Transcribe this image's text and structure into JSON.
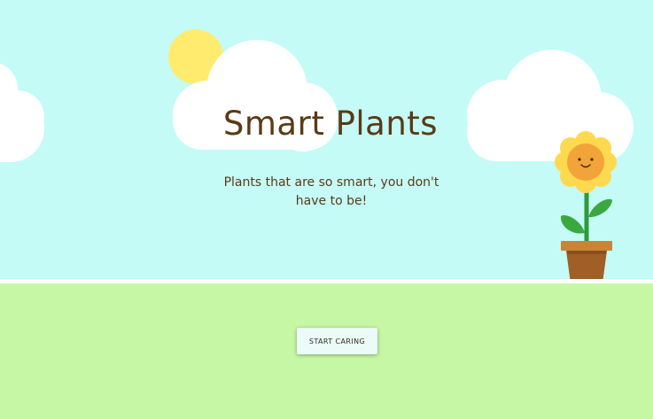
{
  "hero": {
    "title": "Smart Plants",
    "tagline": "Plants that are so smart, you don't have to be!"
  },
  "actions": {
    "start_label": "START CARING"
  },
  "colors": {
    "sky": "#c4fbf6",
    "ground": "#c5f7a5",
    "sun": "#ffec6e",
    "title_text": "#5a3a16",
    "petals": "#fdd94f",
    "flower_face": "#f2a33a",
    "stem": "#2e9a3a",
    "leaf": "#3aa83f",
    "pot": "#a05f26",
    "pot_rim": "#c98537"
  },
  "icons": {
    "sun": "sun-icon",
    "clouds": "cloud-icon",
    "flower": "smiling-flower-in-pot-icon"
  }
}
